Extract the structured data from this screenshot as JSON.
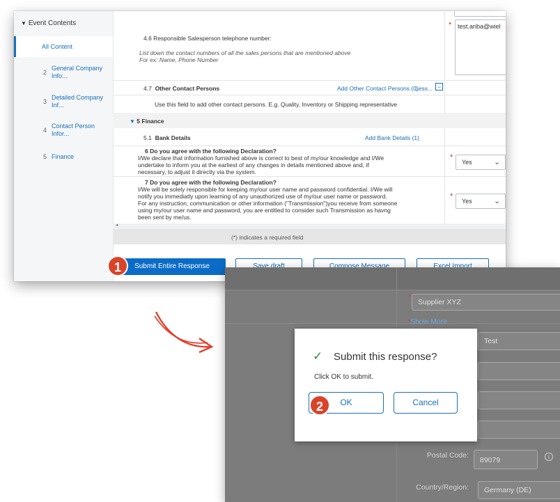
{
  "sidebar": {
    "header": "Event Contents",
    "items": [
      {
        "num": "",
        "label": "All Content"
      },
      {
        "num": "2",
        "label": "General Company Info..."
      },
      {
        "num": "3",
        "label": "Detailed Company Inf..."
      },
      {
        "num": "4",
        "label": "Contact Person Infor..."
      },
      {
        "num": "5",
        "label": "Finance"
      }
    ]
  },
  "main": {
    "email_value": "test.ariba@wiel",
    "q46_label": "4.6  Responsible Salesperson telephone number:",
    "q46_hint_1": "List down the contact numbers of all the sales persons that are mentioned above",
    "q46_hint_2": "For ex: Name, Phone Number",
    "q47_num": "4.7",
    "q47_label": "Other Contact Persons",
    "q47_link": "Add Other Contact Persons (0)",
    "q47_less": "Less...",
    "q47_minus": "−",
    "q47_hint": "Use this field to add other contact persons. E.g. Quality, Inventory or Shipping representative",
    "section5": "5  Finance",
    "q51_num": "5.1",
    "q51_label": "Bank Details",
    "q51_link": "Add Bank Details (1)",
    "q6_title": "6  Do you agree with the following Declaration?",
    "q6_line1": "I/We declare that information furnished above is correct to best of my/our knowledge and I/We",
    "q6_line2": "undertake to inform you at the earliest of any changes in details mentioned above and, if",
    "q6_line3": "necessary, to adjust it directly via the system.",
    "q6_value": "Yes",
    "q7_title": "7  Do you agree with the following Declaration?",
    "q7_line1": "I/We will be solely responsible for keeping my/our user name and password confidential. I/We will",
    "q7_line2": "notify you immediatly upon learning of any unauthorized use of my/our user name or password.",
    "q7_line3": "For any instruction, communication or other information (\"Transmission\")you receive from someone",
    "q7_line4": "using my/our user name and password, you are entitled to consider such Transmission as havng",
    "q7_line5": "been sent by me/us.",
    "q7_value": "Yes",
    "required_note": "(*) indicates a required field"
  },
  "toolbar": {
    "submit": "Submit Entire Response",
    "save": "Save draft",
    "compose": "Compose Message",
    "excel": "Excel Import"
  },
  "badges": {
    "step1": "1",
    "step2": "2"
  },
  "window2": {
    "supplier": "Supplier XYZ",
    "show_more": "Show More",
    "test_value": "Test",
    "postal_label": "Postal Code:",
    "postal_value": "89079",
    "country_label": "Country/Region:",
    "country_value": "Germany (DE)"
  },
  "dialog": {
    "title": "Submit this response?",
    "message": "Click OK to submit.",
    "ok": "OK",
    "cancel": "Cancel"
  },
  "colors": {
    "primary": "#0b6cc7",
    "badge": "#d9432a",
    "arrow": "#e0402a",
    "check": "#2e8540"
  }
}
